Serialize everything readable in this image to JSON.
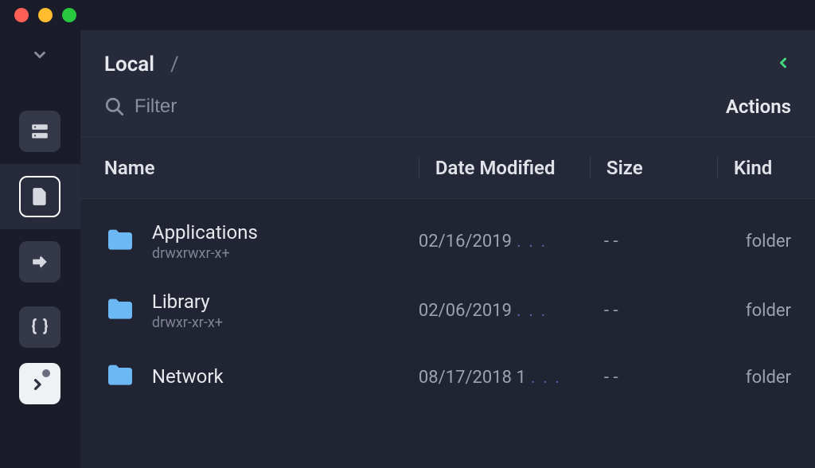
{
  "header": {
    "location_label": "Local",
    "path_sep": "/",
    "filter_placeholder": "Filter",
    "actions_label": "Actions"
  },
  "columns": {
    "name": "Name",
    "date": "Date Modified",
    "size": "Size",
    "kind": "Kind"
  },
  "rows": [
    {
      "name": "Applications",
      "perms": "drwxrwxr-x+",
      "date": "02/16/2019",
      "date_trail": ". . .",
      "size": "- -",
      "kind": "folder"
    },
    {
      "name": "Library",
      "perms": "drwxr-xr-x+",
      "date": "02/06/2019",
      "date_trail": ". . .",
      "size": "- -",
      "kind": "folder"
    },
    {
      "name": "Network",
      "perms": "",
      "date": "08/17/2018 1",
      "date_trail": ". . .",
      "size": "- -",
      "kind": "folder"
    }
  ]
}
